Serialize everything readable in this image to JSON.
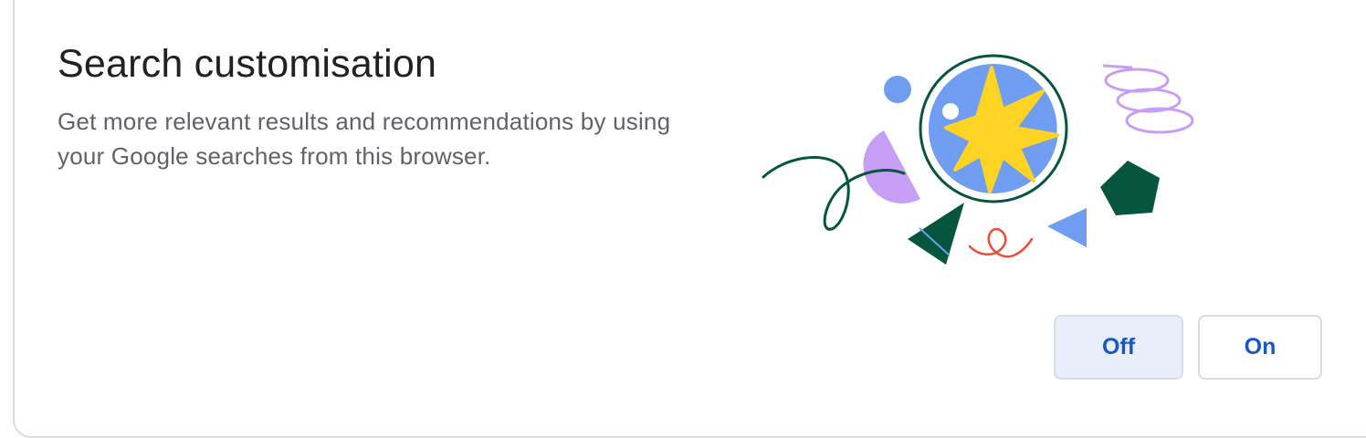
{
  "card": {
    "title": "Search customisation",
    "description": "Get more relevant results and recommendations by using your Google searches from this browser."
  },
  "buttons": {
    "off_label": "Off",
    "on_label": "On",
    "selected": "Off"
  },
  "colors": {
    "title_text": "#202124",
    "body_text": "#5f6368",
    "accent_blue": "#1a56c7",
    "selected_bg": "#e8eefa",
    "border": "#dadce0",
    "illustration_blue": "#6e9df2",
    "illustration_yellow": "#fdd324",
    "illustration_green": "#05553f",
    "illustration_purple": "#c79ef5",
    "illustration_red": "#ee4b3b"
  }
}
